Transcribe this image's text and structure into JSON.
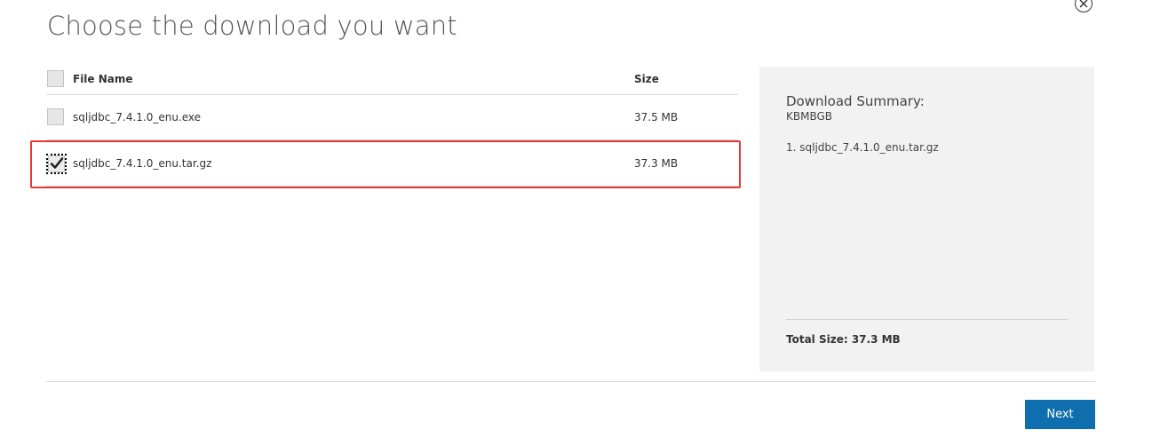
{
  "header": {
    "title": "Choose the download you want"
  },
  "table": {
    "columns": {
      "file_name": "File Name",
      "size": "Size"
    },
    "rows": [
      {
        "name": "sqljdbc_7.4.1.0_enu.exe",
        "size": "37.5 MB",
        "checked": false
      },
      {
        "name": "sqljdbc_7.4.1.0_enu.tar.gz",
        "size": "37.3 MB",
        "checked": true
      }
    ]
  },
  "summary": {
    "title": "Download Summary:",
    "subtitle": "KBMBGB",
    "items": [
      "1. sqljdbc_7.4.1.0_enu.tar.gz"
    ],
    "total": "Total Size: 37.3 MB"
  },
  "footer": {
    "next_label": "Next"
  },
  "colors": {
    "accent": "#0f6fae",
    "highlight": "#e53935",
    "panel_bg": "#f2f2f2"
  },
  "icons": {
    "close": "close-circle-icon",
    "check": "checkmark-icon"
  }
}
